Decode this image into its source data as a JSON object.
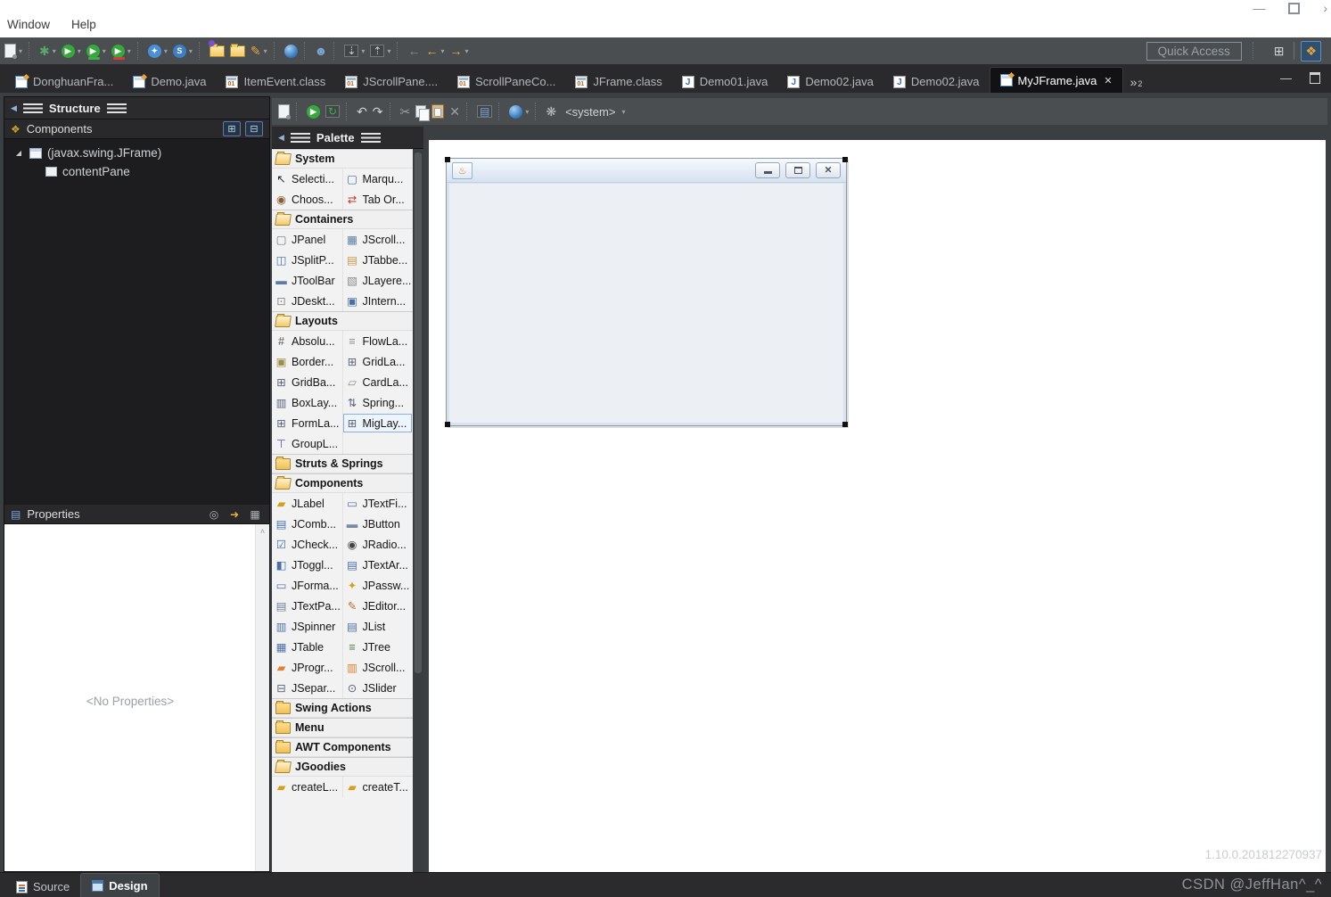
{
  "titlebar": {
    "menus": [
      "Window",
      "Help"
    ],
    "controls": [
      {
        "name": "window-minimize-icon",
        "glyph": "—"
      },
      {
        "name": "window-restore-icon",
        "shape": "restore"
      },
      {
        "name": "window-more-icon",
        "glyph": "›"
      }
    ]
  },
  "main_toolbar": {
    "quick_access": "Quick Access",
    "groups": [
      [
        {
          "name": "new-icon",
          "shape": "page",
          "dropdown": true
        }
      ],
      [
        {
          "name": "debug-icon",
          "glyph": "✱",
          "color": "#59a869",
          "dropdown": true
        },
        {
          "name": "run-icon",
          "glyph": "▶",
          "bg": "#36a93c",
          "color": "#ffffff",
          "dropdown": true
        },
        {
          "name": "run-as-icon",
          "glyph": "▶",
          "bg": "#36a93c",
          "color": "#ffffff",
          "underline": "#3fae49",
          "dropdown": true
        },
        {
          "name": "profile-icon",
          "glyph": "▶",
          "bg": "#36a93c",
          "color": "#ffffff",
          "underline": "#d33c3c",
          "dropdown": true
        }
      ],
      [
        {
          "name": "new-java-project-icon",
          "glyph": "✦",
          "bg": "#4a90d9",
          "color": "#ffffff",
          "dropdown": true
        },
        {
          "name": "new-snippet-icon",
          "glyph": "S",
          "bg": "#3b7fc4",
          "color": "#ffffff",
          "dropdown": true
        }
      ],
      [
        {
          "name": "open-type-icon",
          "shape": "folder",
          "dot": "#7a4fd0"
        },
        {
          "name": "open-resource-icon",
          "shape": "folder"
        },
        {
          "name": "highlighter-icon",
          "glyph": "✎",
          "color": "#e8a33d",
          "dropdown": true
        }
      ],
      [
        {
          "name": "web-browser-icon",
          "shape": "globe"
        }
      ],
      [
        {
          "name": "team-user-icon",
          "glyph": "☻",
          "color": "#7aa7d8"
        }
      ],
      [
        {
          "name": "last-edit-location-icon",
          "glyph": "⇣",
          "color": "#c8c8c8",
          "boxed": true,
          "dropdown": true
        },
        {
          "name": "next-annotation-icon",
          "glyph": "⇡",
          "color": "#c8c8c8",
          "boxed": true,
          "dropdown": true
        }
      ],
      [
        {
          "name": "back-disabled-icon",
          "glyph": "←",
          "color": "#8a8f94"
        },
        {
          "name": "back-icon",
          "glyph": "←",
          "color": "#e8b339",
          "dropdown": true
        },
        {
          "name": "forward-icon",
          "glyph": "→",
          "color": "#e8b339",
          "dropdown": true
        }
      ]
    ],
    "perspectives": [
      {
        "name": "open-perspective-icon",
        "glyph": "⊞",
        "color": "#cfd3d6"
      },
      {
        "name": "windowbuilder-perspective-icon",
        "glyph": "❖",
        "color": "#e8a33d",
        "active": true
      }
    ]
  },
  "editor_tabs": {
    "tabs": [
      {
        "label": "DonghuanFra...",
        "icon": "designer"
      },
      {
        "label": "Demo.java",
        "icon": "designer"
      },
      {
        "label": "ItemEvent.class",
        "icon": "class"
      },
      {
        "label": "JScrollPane....",
        "icon": "class"
      },
      {
        "label": "ScrollPaneCo...",
        "icon": "class"
      },
      {
        "label": "JFrame.class",
        "icon": "class"
      },
      {
        "label": "Demo01.java",
        "icon": "java"
      },
      {
        "label": "Demo02.java",
        "icon": "java"
      },
      {
        "label": "Demo02.java",
        "icon": "java"
      },
      {
        "label": "MyJFrame.java",
        "icon": "designer",
        "active": true,
        "closable": true
      }
    ],
    "overflow": {
      "glyph": "»",
      "count": "2"
    },
    "view_controls": [
      {
        "name": "minimize-view-icon",
        "glyph": "—"
      },
      {
        "name": "maximize-view-icon",
        "shape": "maxbox"
      }
    ]
  },
  "structure_panel": {
    "tab": "Structure",
    "components_title": "Components",
    "components_icon": {
      "name": "components-icon",
      "glyph": "❖",
      "color": "#c9a227"
    },
    "toolbar": [
      {
        "name": "expand-all-icon",
        "glyph": "⊞"
      },
      {
        "name": "collapse-all-icon",
        "glyph": "⊟"
      }
    ],
    "tree": [
      {
        "label": "(javax.swing.JFrame)",
        "depth": 0,
        "icon": "jframe",
        "expanded": true
      },
      {
        "label": "contentPane",
        "depth": 1,
        "icon": "content-pane"
      }
    ]
  },
  "properties_panel": {
    "title": "Properties",
    "title_icon": {
      "name": "properties-icon",
      "glyph": "▤",
      "color": "#7aa7d8"
    },
    "empty_text": "<No Properties>",
    "scroll_up_glyph": "˄",
    "toolbar": [
      {
        "name": "show-advanced-properties-icon",
        "glyph": "◎",
        "color": "#b0b4b8"
      },
      {
        "name": "goto-definition-icon",
        "glyph": "➜",
        "color": "#e8b339"
      },
      {
        "name": "configure-properties-icon",
        "glyph": "▦",
        "color": "#b0b4b8"
      }
    ]
  },
  "design_toolbar": {
    "groups": [
      [
        {
          "name": "reparse-icon",
          "shape": "page"
        }
      ],
      [
        {
          "name": "test-window-icon",
          "glyph": "▶",
          "bg": "#36a93c",
          "color": "#ffffff"
        },
        {
          "name": "refresh-icon",
          "glyph": "↻",
          "color": "#3fae49",
          "boxed": true
        }
      ],
      [
        {
          "name": "undo-icon",
          "glyph": "↶",
          "color": "#cfd3d6"
        },
        {
          "name": "redo-icon",
          "glyph": "↷",
          "color": "#cfd3d6"
        }
      ],
      [
        {
          "name": "cut-icon",
          "glyph": "✂",
          "color": "#9aa0a6"
        },
        {
          "name": "copy-icon",
          "shape": "copy"
        },
        {
          "name": "paste-icon",
          "shape": "paste"
        },
        {
          "name": "delete-icon",
          "glyph": "✕",
          "color": "#9aa0a6"
        }
      ],
      [
        {
          "name": "externalize-strings-icon",
          "glyph": "▤",
          "color": "#7aa7d8",
          "boxed": true
        }
      ],
      [
        {
          "name": "locale-globe-icon",
          "shape": "globe",
          "dropdown": true
        }
      ],
      [
        {
          "name": "look-and-feel-icon",
          "glyph": "❋",
          "color": "#b8bcc0"
        },
        {
          "name": "look-and-feel-selector",
          "label": "<system>",
          "dropdown": true
        }
      ]
    ],
    "system_label": "<system>"
  },
  "palette": {
    "tab": "Palette",
    "sections": [
      {
        "name": "System",
        "open": true,
        "items": [
          {
            "label": "Selecti...",
            "icon": "selection-cursor",
            "glyph": "↖",
            "color": "#222222"
          },
          {
            "label": "Marqu...",
            "icon": "marquee",
            "glyph": "▢",
            "color": "#3b6fb5"
          },
          {
            "label": "Choos...",
            "icon": "choose-bean",
            "glyph": "◉",
            "color": "#8b5e34"
          },
          {
            "label": "Tab Or...",
            "icon": "tab-order",
            "glyph": "⇄",
            "color": "#c0392b"
          }
        ]
      },
      {
        "name": "Containers",
        "open": true,
        "items": [
          {
            "label": "JPanel",
            "icon": "jpanel",
            "glyph": "▢",
            "color": "#777777"
          },
          {
            "label": "JScroll...",
            "icon": "jscrollpane",
            "glyph": "▦",
            "color": "#5b7ca6"
          },
          {
            "label": "JSplitP...",
            "icon": "jsplitpane",
            "glyph": "◫",
            "color": "#4a6fa5"
          },
          {
            "label": "JTabbe...",
            "icon": "jtabbedpane",
            "glyph": "▤",
            "color": "#c49a4a"
          },
          {
            "label": "JToolBar",
            "icon": "jtoolbar",
            "glyph": "▬",
            "color": "#5b7ca6"
          },
          {
            "label": "JLayere...",
            "icon": "jlayeredpane",
            "glyph": "▧",
            "color": "#888888"
          },
          {
            "label": "JDeskt...",
            "icon": "jdesktoppane",
            "glyph": "⊡",
            "color": "#888888"
          },
          {
            "label": "JIntern...",
            "icon": "jinternalframe",
            "glyph": "▣",
            "color": "#4a6fa5"
          }
        ]
      },
      {
        "name": "Layouts",
        "open": true,
        "items": [
          {
            "label": "Absolu...",
            "icon": "absolute-layout",
            "glyph": "#",
            "color": "#555555"
          },
          {
            "label": "FlowLa...",
            "icon": "flow-layout",
            "glyph": "≡",
            "color": "#888888"
          },
          {
            "label": "Border...",
            "icon": "border-layout",
            "glyph": "▣",
            "color": "#9a8b4a"
          },
          {
            "label": "GridLa...",
            "icon": "grid-layout",
            "glyph": "⊞",
            "color": "#55617a"
          },
          {
            "label": "GridBa...",
            "icon": "gridbag-layout",
            "glyph": "⊞",
            "color": "#55617a"
          },
          {
            "label": "CardLa...",
            "icon": "card-layout",
            "glyph": "▱",
            "color": "#888888"
          },
          {
            "label": "BoxLay...",
            "icon": "box-layout",
            "glyph": "▥",
            "color": "#55617a"
          },
          {
            "label": "Spring...",
            "icon": "spring-layout",
            "glyph": "⇅",
            "color": "#55617a"
          },
          {
            "label": "FormLa...",
            "icon": "form-layout",
            "glyph": "⊞",
            "color": "#55617a"
          },
          {
            "label": "MigLay...",
            "icon": "mig-layout",
            "glyph": "⊞",
            "color": "#55617a",
            "selected": true
          },
          {
            "label": "GroupL...",
            "icon": "group-layout",
            "glyph": "⊤",
            "color": "#4a55c4"
          }
        ]
      },
      {
        "name": "Struts & Springs",
        "open": false,
        "items": []
      },
      {
        "name": "Components",
        "open": true,
        "items": [
          {
            "label": "JLabel",
            "icon": "jlabel",
            "glyph": "▰",
            "color": "#d4a017"
          },
          {
            "label": "JTextFi...",
            "icon": "jtextfield",
            "glyph": "▭",
            "color": "#4a6fa5"
          },
          {
            "label": "JComb...",
            "icon": "jcombobox",
            "glyph": "▤",
            "color": "#4a6fa5"
          },
          {
            "label": "JButton",
            "icon": "jbutton",
            "glyph": "▬",
            "color": "#7a8aa0"
          },
          {
            "label": "JCheck...",
            "icon": "jcheckbox",
            "glyph": "☑",
            "color": "#3b6fb5"
          },
          {
            "label": "JRadio...",
            "icon": "jradiobutton",
            "glyph": "◉",
            "color": "#444444"
          },
          {
            "label": "JToggl...",
            "icon": "jtogglebutton",
            "glyph": "◧",
            "color": "#4a6fa5"
          },
          {
            "label": "JTextAr...",
            "icon": "jtextarea",
            "glyph": "▤",
            "color": "#4a6fa5"
          },
          {
            "label": "JForma...",
            "icon": "jformattedtextfield",
            "glyph": "▭",
            "color": "#4a6fa5"
          },
          {
            "label": "JPassw...",
            "icon": "jpasswordfield",
            "glyph": "✦",
            "color": "#d4a017"
          },
          {
            "label": "JTextPa...",
            "icon": "jtextpane",
            "glyph": "▤",
            "color": "#6a7f9a"
          },
          {
            "label": "JEditor...",
            "icon": "jeditorpane",
            "glyph": "✎",
            "color": "#c07030"
          },
          {
            "label": "JSpinner",
            "icon": "jspinner",
            "glyph": "▥",
            "color": "#4a6fa5"
          },
          {
            "label": "JList",
            "icon": "jlist",
            "glyph": "▤",
            "color": "#4a6fa5"
          },
          {
            "label": "JTable",
            "icon": "jtable",
            "glyph": "▦",
            "color": "#4a6fa5"
          },
          {
            "label": "JTree",
            "icon": "jtree",
            "glyph": "≡",
            "color": "#3a7f3a"
          },
          {
            "label": "JProgr...",
            "icon": "jprogressbar",
            "glyph": "▰",
            "color": "#e08030"
          },
          {
            "label": "JScroll...",
            "icon": "jscrollbar",
            "glyph": "▥",
            "color": "#e08030"
          },
          {
            "label": "JSepar...",
            "icon": "jseparator",
            "glyph": "⊟",
            "color": "#55617a"
          },
          {
            "label": "JSlider",
            "icon": "jslider",
            "glyph": "⊙",
            "color": "#55617a"
          }
        ]
      },
      {
        "name": "Swing Actions",
        "open": false,
        "items": []
      },
      {
        "name": "Menu",
        "open": false,
        "items": []
      },
      {
        "name": "AWT Components",
        "open": false,
        "items": []
      },
      {
        "name": "JGoodies",
        "open": true,
        "items": [
          {
            "label": "createL...",
            "icon": "jgoodies-create-label",
            "glyph": "▰",
            "color": "#d4a017"
          },
          {
            "label": "createT...",
            "icon": "jgoodies-create-title",
            "glyph": "▰",
            "color": "#d4a017"
          }
        ]
      }
    ]
  },
  "frame_preview": {
    "java_icon_glyph": "♨",
    "buttons": [
      {
        "name": "frame-minimize-button",
        "shape": "min"
      },
      {
        "name": "frame-maximize-button",
        "shape": "max"
      },
      {
        "name": "frame-close-button",
        "glyph": "✕"
      }
    ]
  },
  "bottom_tabs": {
    "tabs": [
      {
        "label": "Source",
        "icon": "source"
      },
      {
        "label": "Design",
        "icon": "design",
        "active": true
      }
    ]
  },
  "watermarks": {
    "version": "1.10.0.201812270937",
    "credit": "CSDN @JeffHan^_^"
  }
}
